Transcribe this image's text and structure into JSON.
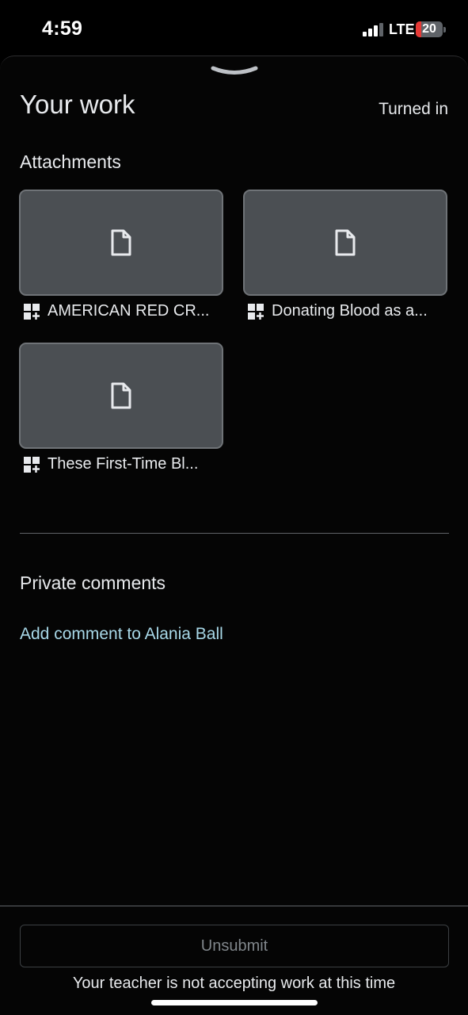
{
  "status": {
    "time": "4:59",
    "network": "LTE",
    "battery": "20",
    "battery_level": 0.2,
    "signal_bars": 3
  },
  "sheet": {
    "title": "Your work",
    "status": "Turned in",
    "handle_icon": "chevron-down-icon"
  },
  "attachments": {
    "heading": "Attachments",
    "items": [
      {
        "label": "AMERICAN RED CR...",
        "icon": "file-icon",
        "badge_icon": "addon-icon"
      },
      {
        "label": "Donating Blood as a...",
        "icon": "file-icon",
        "badge_icon": "addon-icon"
      },
      {
        "label": "These First-Time Bl...",
        "icon": "file-icon",
        "badge_icon": "addon-icon"
      }
    ]
  },
  "comments": {
    "heading": "Private comments",
    "add_label": "Add comment to Alania Ball"
  },
  "footer": {
    "unsubmit_label": "Unsubmit",
    "notice": "Your teacher is not accepting work at this time"
  },
  "colors": {
    "background": "#000000",
    "card": "#4b4f53",
    "link": "#a8d8e8",
    "battery_low": "#e53935"
  }
}
